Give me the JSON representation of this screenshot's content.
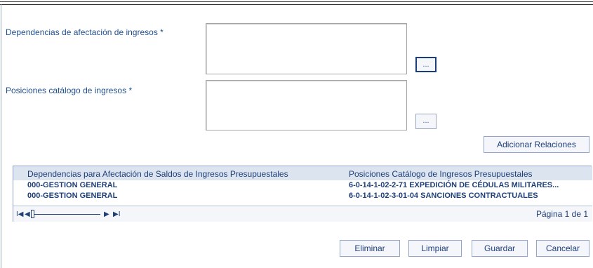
{
  "form": {
    "dependencias_label": "Dependencias de afectación de ingresos *",
    "posiciones_label": "Posiciones catálogo de ingresos *",
    "browse_label": "...",
    "adicionar_label": "Adicionar Relaciones"
  },
  "grid": {
    "columns": [
      "Dependencias para Afectación de Saldos de Ingresos Presupuestales",
      "Posiciones Catálogo de Ingresos Presupuestales"
    ],
    "rows": [
      {
        "dependencia": "000-GESTION GENERAL",
        "posicion": "6-0-14-1-02-2-71 EXPEDICIÓN DE CÉDULAS MILITARES..."
      },
      {
        "dependencia": "000-GESTION GENERAL",
        "posicion": "6-0-14-1-02-3-01-04 SANCIONES CONTRACTUALES"
      }
    ],
    "pager": {
      "first": "I◀",
      "prev": "◀",
      "next": "▶",
      "last": "▶I",
      "page_text": "Página 1 de 1"
    }
  },
  "actions": {
    "eliminar": "Eliminar",
    "limpiar": "Limpiar",
    "guardar": "Guardar",
    "cancelar": "Cancelar"
  }
}
